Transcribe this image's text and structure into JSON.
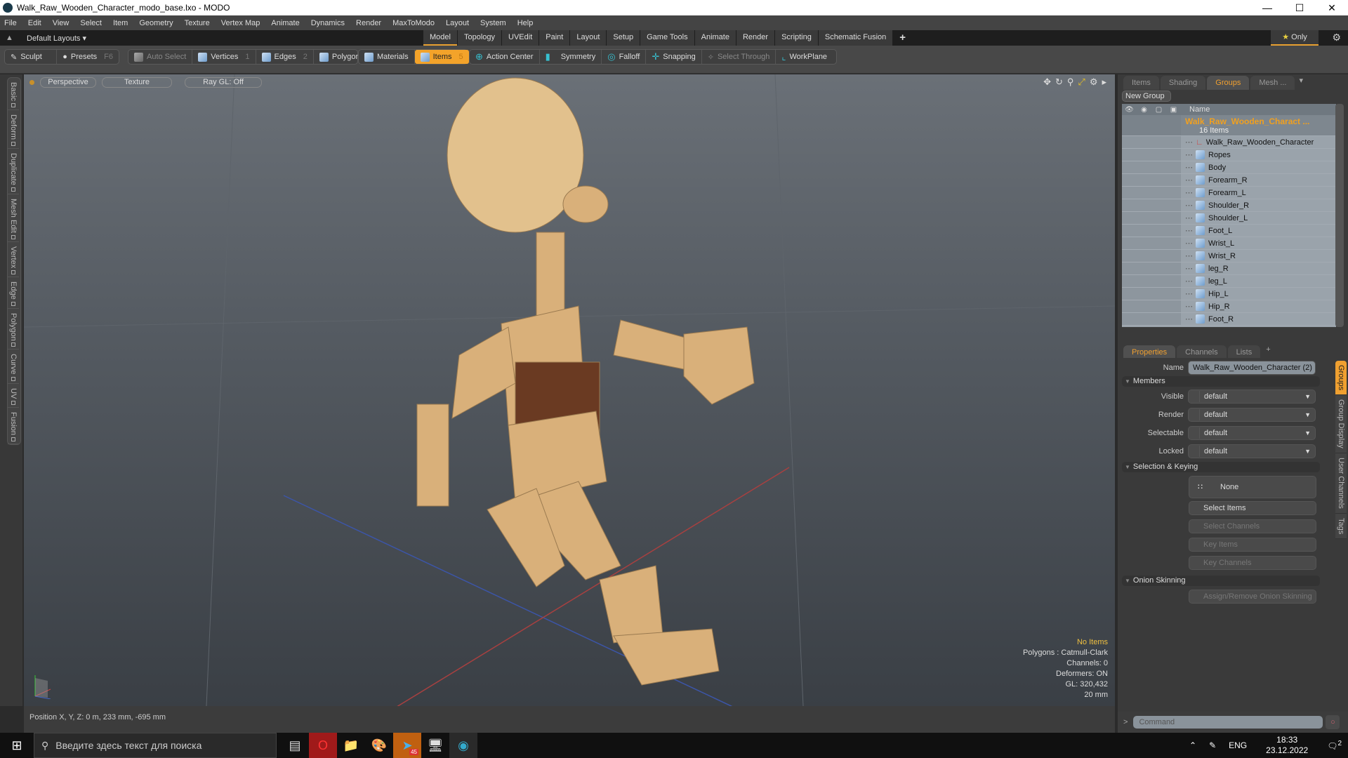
{
  "window": {
    "title": "Walk_Raw_Wooden_Character_modo_base.lxo - MODO",
    "controls": [
      "minimize",
      "maximize",
      "close"
    ]
  },
  "menu": [
    "File",
    "Edit",
    "View",
    "Select",
    "Item",
    "Geometry",
    "Texture",
    "Vertex Map",
    "Animate",
    "Dynamics",
    "Render",
    "MaxToModo",
    "Layout",
    "System",
    "Help"
  ],
  "layout": {
    "label": "Default Layouts",
    "tabs": [
      "Model",
      "Topology",
      "UVEdit",
      "Paint",
      "Layout",
      "Setup",
      "Game Tools",
      "Animate",
      "Render",
      "Scripting",
      "Schematic Fusion"
    ],
    "active": "Model",
    "only_label": "Only"
  },
  "toolbar": {
    "sculpt": "Sculpt",
    "presets": "Presets",
    "presets_key": "F6",
    "auto_select": "Auto Select",
    "vertices": "Vertices",
    "vertices_key": "1",
    "edges": "Edges",
    "edges_key": "2",
    "polygons": "Polygons",
    "materials": "Materials",
    "items": "Items",
    "items_key": "5",
    "action_center": "Action Center",
    "symmetry": "Symmetry",
    "falloff": "Falloff",
    "snapping": "Snapping",
    "select_through": "Select Through",
    "workplane": "WorkPlane"
  },
  "left_tabs": [
    "Basic",
    "Deform",
    "Duplicate",
    "Mesh Edit",
    "Vertex",
    "Edge",
    "Polygon",
    "Curve",
    "UV",
    "Fusion"
  ],
  "viewport": {
    "view": "Perspective",
    "shading": "Texture",
    "raygl": "Ray GL: Off",
    "stats": {
      "selection": "No Items",
      "polygons": "Polygons : Catmull-Clark",
      "channels": "Channels: 0",
      "deformers": "Deformers: ON",
      "gl": "GL: 320,432",
      "grid": "20 mm"
    },
    "accent": "#f0c040"
  },
  "status": {
    "position": "Position X, Y, Z:   0 m, 233 mm, -695 mm"
  },
  "groups_panel": {
    "tabs": [
      "Items",
      "Shading",
      "Groups",
      "Mesh ..."
    ],
    "active": "Groups",
    "new_group": "New Group",
    "name_header": "Name",
    "group": {
      "name": "Walk_Raw_Wooden_Charact ...",
      "count": "16 Items"
    },
    "items": [
      "Walk_Raw_Wooden_Character",
      "Ropes",
      "Body",
      "Forearm_R",
      "Forearm_L",
      "Shoulder_R",
      "Shoulder_L",
      "Foot_L",
      "Wrist_L",
      "Wrist_R",
      "leg_R",
      "leg_L",
      "Hip_L",
      "Hip_R",
      "Foot_R"
    ]
  },
  "properties": {
    "tabs": [
      "Properties",
      "Channels",
      "Lists"
    ],
    "active": "Properties",
    "name_label": "Name",
    "name_value": "Walk_Raw_Wooden_Character (2)",
    "members_label": "Members",
    "members": [
      {
        "label": "Visible",
        "value": "default"
      },
      {
        "label": "Render",
        "value": "default"
      },
      {
        "label": "Selectable",
        "value": "default"
      },
      {
        "label": "Locked",
        "value": "default"
      }
    ],
    "selection_label": "Selection & Keying",
    "none": "None",
    "select_items": "Select Items",
    "select_channels": "Select Channels",
    "key_items": "Key Items",
    "key_channels": "Key Channels",
    "onion_label": "Onion Skinning",
    "onion_btn": "Assign/Remove Onion Skinning",
    "side_tabs": [
      "Groups",
      "Group Display",
      "User Channels",
      "Tags"
    ]
  },
  "command": {
    "placeholder": "Command"
  },
  "taskbar": {
    "search": "Введите здесь текст для поиска",
    "lang": "ENG",
    "time": "18:33",
    "date": "23.12.2022",
    "notifications": "2",
    "telegram_badge": "45"
  }
}
